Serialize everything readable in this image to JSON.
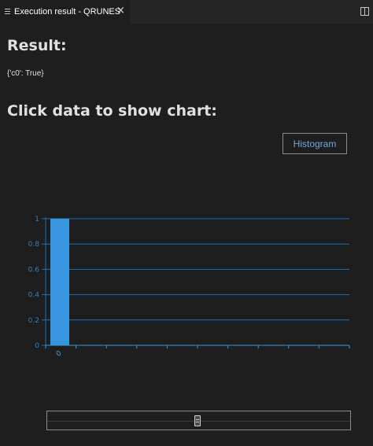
{
  "tab": {
    "title": "Execution result - QRUNES",
    "close_glyph": "×"
  },
  "result": {
    "heading": "Result:",
    "value": "{'c0': True}"
  },
  "chart_section": {
    "heading": "Click data to show chart:",
    "histogram_button": "Histogram"
  },
  "colors": {
    "background": "#1e1e1e",
    "tabbar": "#252526",
    "heading_text": "#e0e0e0",
    "accent_blue": "#3795de",
    "grid_blue": "#1c6fb8",
    "button_text": "#6fa8dc"
  },
  "icons": {
    "tab": "list-icon",
    "split": "split-editor-icon",
    "close": "close-icon"
  },
  "chart_data": {
    "type": "bar",
    "categories": [
      "0"
    ],
    "values": [
      1
    ],
    "ylim": [
      0,
      1
    ],
    "yticks": [
      "0",
      "0.2",
      "0.4",
      "0.6",
      "0.8",
      "1"
    ],
    "title": "",
    "xlabel": "",
    "ylabel": "",
    "grid": true,
    "legend": "none"
  }
}
